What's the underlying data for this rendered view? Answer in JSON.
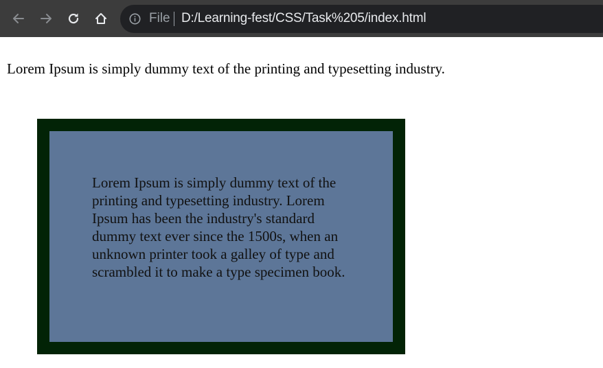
{
  "browser": {
    "address_scheme": "File",
    "address_url": "D:/Learning-fest/CSS/Task%205/index.html",
    "icons": {
      "back": "arrow-left",
      "forward": "arrow-right",
      "reload": "reload",
      "home": "home",
      "site_info": "info-circle"
    },
    "colors": {
      "toolbar": "#3c3c3c",
      "omnibox": "#202124",
      "url_text": "#e8eaed",
      "muted": "#9aa0a6"
    }
  },
  "page": {
    "intro_text": "Lorem Ipsum is simply dummy text of the printing and typesetting industry.",
    "box_text": "Lorem Ipsum is simply dummy text of the printing and typesetting industry. Lorem Ipsum has been the industry's standard dummy text ever since the 1500s, when an unknown printer took a galley of type and scrambled it to make a type specimen book.",
    "colors": {
      "outer_box": "#022306",
      "inner_box": "#5d7698"
    }
  }
}
